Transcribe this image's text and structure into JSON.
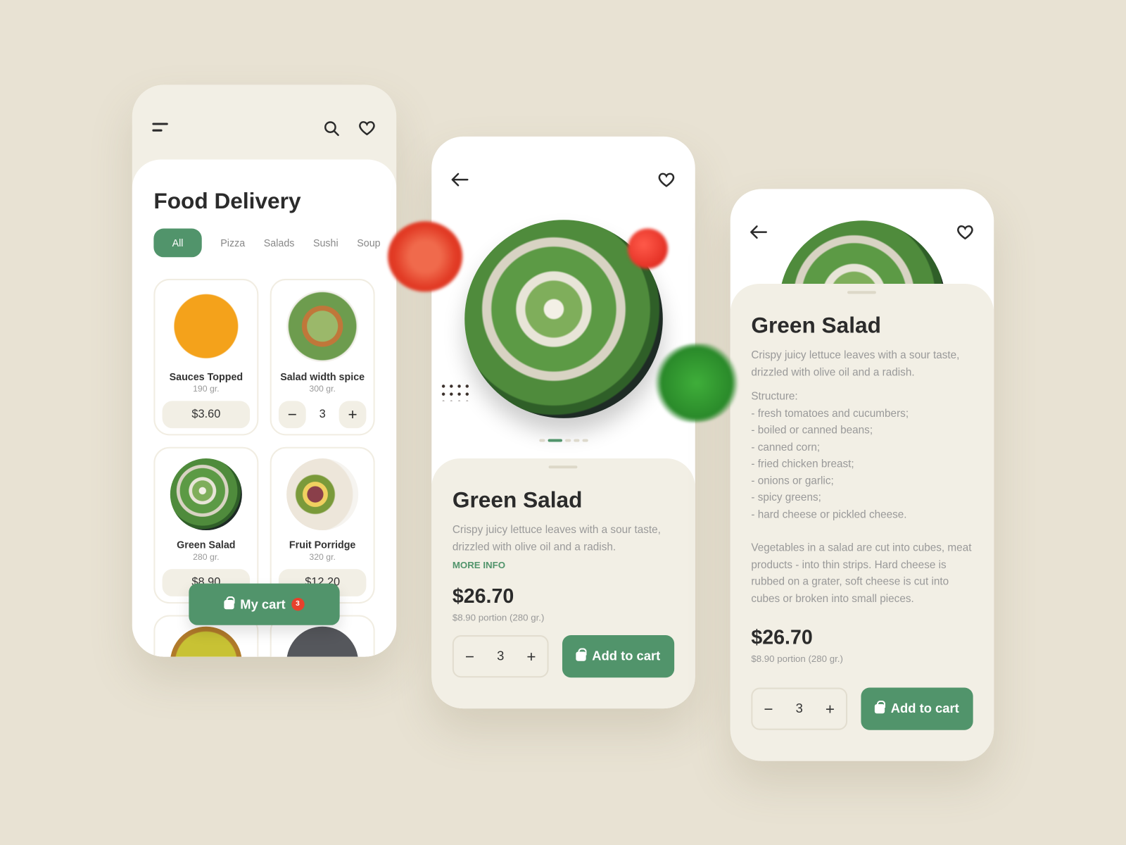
{
  "colors": {
    "background": "#e8e2d3",
    "accent": "#51946b",
    "panel": "#f2efe5",
    "badge": "#e8412c"
  },
  "list_screen": {
    "title": "Food Delivery",
    "categories": [
      {
        "label": "All",
        "active": true
      },
      {
        "label": "Pizza"
      },
      {
        "label": "Salads"
      },
      {
        "label": "Sushi"
      },
      {
        "label": "Soup"
      }
    ],
    "items": [
      {
        "name": "Sauces Topped",
        "weight": "190 gr.",
        "price": "$3.60"
      },
      {
        "name": "Salad width spice",
        "weight": "300 gr.",
        "quantity": "3",
        "minus": "−",
        "plus": "+"
      },
      {
        "name": "Green Salad",
        "weight": "280 gr.",
        "price": "$8.90"
      },
      {
        "name": "Fruit Porridge",
        "weight": "320 gr.",
        "price": "$12.20"
      }
    ],
    "cart": {
      "label": "My cart",
      "count": "3"
    }
  },
  "detail_screen": {
    "title": "Green Salad",
    "description": "Crispy juicy lettuce leaves with a sour taste, drizzled with olive oil and a radish.",
    "more_info": "MORE INFO",
    "price": "$26.70",
    "portion": "$8.90 portion (280 gr.)",
    "quantity": "3",
    "minus": "−",
    "plus": "+",
    "add_to_cart": "Add to cart",
    "carousel_active_index": 1,
    "carousel_count": 5
  },
  "expanded_screen": {
    "title": "Green Salad",
    "description": "Crispy juicy lettuce leaves with a sour taste, drizzled with olive oil and a radish.",
    "structure_heading": "Structure:",
    "structure": [
      "- fresh tomatoes and cucumbers;",
      "- boiled or canned beans;",
      "- canned corn;",
      "- fried chicken breast;",
      "- onions or garlic;",
      "- spicy greens;",
      "- hard cheese or pickled cheese."
    ],
    "notes": "Vegetables in a salad are cut into cubes, meat products - into thin strips. Hard cheese is rubbed on a grater, soft cheese is cut into cubes or broken into small pieces.",
    "price": "$26.70",
    "portion": "$8.90 portion (280 gr.)",
    "quantity": "3",
    "minus": "−",
    "plus": "+",
    "add_to_cart": "Add to cart"
  }
}
